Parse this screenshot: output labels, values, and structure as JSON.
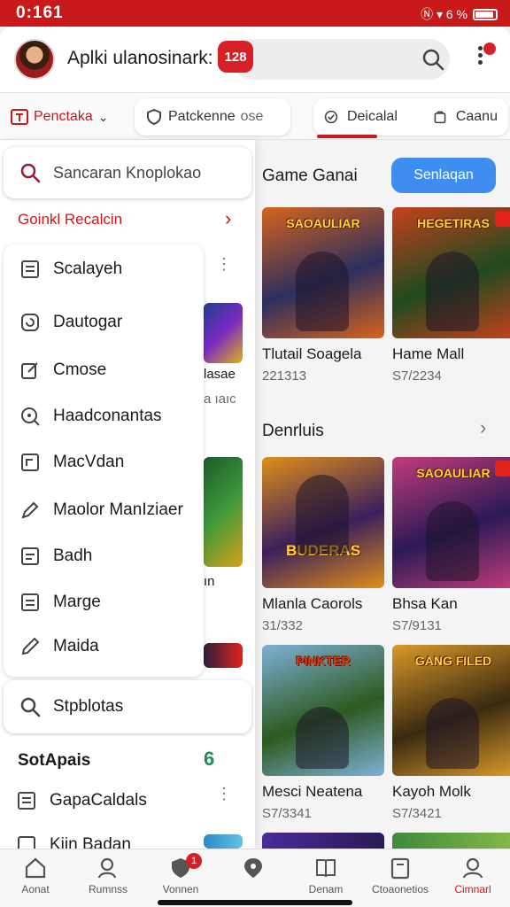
{
  "status_bar": {
    "time": "0:161",
    "indicators": "Ⓝ ▾ 6 %"
  },
  "header": {
    "title": "Aplki ulanosinark:",
    "badge": "128",
    "search_icon": "search-icon",
    "menu_icon": "kebab-icon"
  },
  "tabs": [
    {
      "label": "Penctaka",
      "icon": "tag-icon"
    },
    {
      "label": "Patckenne",
      "icon": "shield-icon"
    },
    {
      "label": "ose",
      "icon": ""
    },
    {
      "label": "Deicalal",
      "icon": "check-circle-icon"
    },
    {
      "label": "Caanu",
      "icon": "bag-icon"
    }
  ],
  "drawer": {
    "search_placeholder": "Sancaran Knoplokao",
    "section_label": "Goinkl Recalcin",
    "items": [
      {
        "label": "Scalayeh",
        "icon": "list-icon"
      },
      {
        "label": "Dautogar",
        "icon": "refresh-icon"
      },
      {
        "label": "Cmose",
        "icon": "edit-icon"
      },
      {
        "label": "Haadconantas",
        "icon": "zoom-icon"
      },
      {
        "label": "MacVdan",
        "icon": "square-icon"
      },
      {
        "label": "Maolor ManIziaer",
        "icon": "pencil-icon"
      },
      {
        "label": "Badh",
        "icon": "doc-icon"
      },
      {
        "label": "Marge",
        "icon": "doc-icon"
      },
      {
        "label": "Maida",
        "icon": "pen-icon"
      }
    ],
    "footer_search": "Stpblotas",
    "subheading": "SotApais",
    "sub_items": [
      {
        "label": "GapaCaldals",
        "icon": "grid-icon"
      },
      {
        "label": "Kiin Badan",
        "icon": "doc-icon"
      }
    ],
    "strip_texts": [
      "lasae",
      "a ıaıc",
      "ın",
      "6"
    ]
  },
  "main": {
    "section1_title": "Game Ganai",
    "see_button": "Senlaqan",
    "section2_title": "Denrluis",
    "cards": [
      {
        "name": "Tlutail Soagela",
        "price": "221313",
        "art": "SAOAULIAR",
        "colors": [
          "#2b2f5e",
          "#d8631c"
        ]
      },
      {
        "name": "Hame Mall",
        "price": "S7/2234",
        "art": "HEGETIRAS",
        "colors": [
          "#1e4a1e",
          "#c6411d"
        ]
      },
      {
        "name": "Mlanla Caorols",
        "price": "31/332",
        "art": "BUDERAS",
        "colors": [
          "#3a1f5c",
          "#e08e1a"
        ]
      },
      {
        "name": "Bhsa Kan",
        "price": "S7/9131",
        "art": "SAOAULIAR",
        "colors": [
          "#2a1a55",
          "#c23c7a"
        ]
      },
      {
        "name": "Mesci Neatena",
        "price": "S7/3341",
        "art": "PINKTER",
        "colors": [
          "#2c5a1e",
          "#7fb1d8"
        ]
      },
      {
        "name": "Kayoh Molk",
        "price": "S7/3421",
        "art": "GANG FILED",
        "colors": [
          "#3a2a10",
          "#d99a2a"
        ]
      }
    ]
  },
  "bottom_nav": [
    {
      "label": "Aonat",
      "icon": "home-icon"
    },
    {
      "label": "Rumnss",
      "icon": "user-search-icon"
    },
    {
      "label": "Vonnen",
      "icon": "shield-heart-icon",
      "badge": "1"
    },
    {
      "label": "",
      "icon": "location-icon"
    },
    {
      "label": "Denam",
      "icon": "book-icon"
    },
    {
      "label": "Ctoaonetios",
      "icon": "card-icon"
    },
    {
      "label": "Cimnarl",
      "icon": "profile-icon"
    }
  ],
  "colors": {
    "brand_red": "#c8191b",
    "accent_blue": "#3d8ef0"
  }
}
